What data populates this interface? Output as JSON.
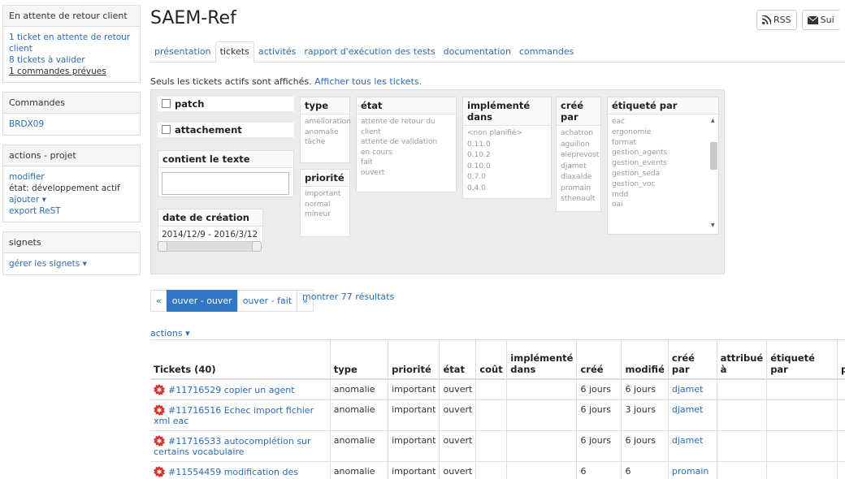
{
  "sidebar": {
    "waiting": {
      "title": "En attente de retour client",
      "items": [
        "1 ticket en attente de retour client",
        "8 tickets à valider",
        "1 commandes prévues"
      ]
    },
    "orders": {
      "title": "Commandes",
      "items": [
        "BRDX09"
      ]
    },
    "actions": {
      "title": "actions - projet",
      "modify": "modifier",
      "state": "état: développement actif",
      "add": "ajouter",
      "export": "export ReST"
    },
    "bookmarks": {
      "title": "signets",
      "manage": "gérer les signets"
    }
  },
  "header": {
    "title": "SAEM-Ref",
    "rss": "RSS",
    "follow": "Sui"
  },
  "tabs": [
    "présentation",
    "tickets",
    "activités",
    "rapport d'exécution des tests",
    "documentation",
    "commandes"
  ],
  "notice": {
    "text": "Seuls les tickets actifs sont affichés.",
    "link": "Afficher tous les tickets."
  },
  "filters": {
    "patch": "patch",
    "attachment": "attachement",
    "contains": "contient le texte",
    "date": {
      "title": "date de création",
      "range": "2014/12/9 - 2016/3/12"
    },
    "type": {
      "title": "type",
      "options": [
        "amélioration",
        "anomalie",
        "tâche"
      ]
    },
    "priority": {
      "title": "priorité",
      "options": [
        "important",
        "normal",
        "mineur"
      ]
    },
    "state": {
      "title": "état",
      "options": [
        "attente de retour du client",
        "attente de validation",
        "en cours",
        "fait",
        "ouvert"
      ]
    },
    "implemented": {
      "title": "implémenté dans",
      "options": [
        "<non planifié>",
        "0.11.0",
        "0.10.2",
        "0.10.0",
        "0.7.0",
        "0.4.0"
      ]
    },
    "created_by": {
      "title": "créé par",
      "options": [
        "achatron",
        "aguillon",
        "aleprevost",
        "djamet",
        "dlaxalde",
        "promain",
        "sthenault"
      ]
    },
    "tagged_by": {
      "title": "étiqueté par",
      "options": [
        "eac",
        "ergonomie",
        "format",
        "gestion_agents",
        "gestion_events",
        "gestion_seda",
        "gestion_voc",
        "mdd",
        "oai"
      ]
    }
  },
  "pager": {
    "prev": "«",
    "current": "ouver - ouver",
    "next_page": "ouver - fait",
    "next": "»",
    "show_all": "montrer 77 résultats"
  },
  "actions_label": "actions",
  "table": {
    "headers": [
      "Tickets (40)",
      "type",
      "priorité",
      "état",
      "coût",
      "implémenté dans",
      "créé",
      "modifié",
      "créé par",
      "attribué à",
      "étiqueté par",
      "pa"
    ],
    "rows": [
      {
        "title": "#11716529 copier un agent",
        "type": "anomalie",
        "priority": "important",
        "state": "ouvert",
        "created": "6 jours",
        "modified": "6 jours",
        "author": "djamet"
      },
      {
        "title": "#11716516 Echec import fichier xml eac",
        "type": "anomalie",
        "priority": "important",
        "state": "ouvert",
        "created": "6 jours",
        "modified": "3 jours",
        "author": "djamet"
      },
      {
        "title": "#11716533 autocomplétion sur certains vocabulaire",
        "type": "anomalie",
        "priority": "important",
        "state": "ouvert",
        "created": "6 jours",
        "modified": "6 jours",
        "author": "djamet"
      },
      {
        "title": "#11554459 modification des",
        "type": "anomalie",
        "priority": "important",
        "state": "ouvert",
        "created": "6",
        "modified": "6",
        "author": "promain"
      }
    ]
  },
  "colors": {
    "link": "#2a6db5",
    "active_page": "#2f78c4",
    "bug": "#d9342b"
  }
}
